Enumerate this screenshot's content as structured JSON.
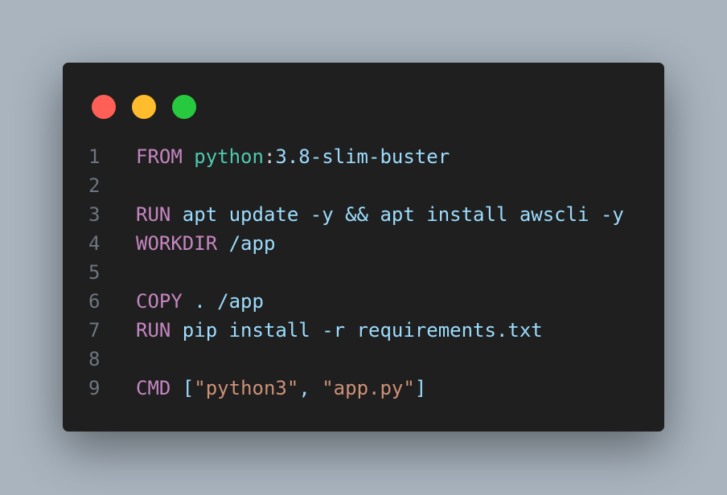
{
  "window_controls": [
    {
      "name": "close",
      "color": "#ff5f56"
    },
    {
      "name": "minimize",
      "color": "#ffbd2e"
    },
    {
      "name": "maximize",
      "color": "#27c93f"
    }
  ],
  "code": {
    "language": "Dockerfile",
    "lines": [
      {
        "number": "1",
        "tokens": [
          {
            "t": "FROM",
            "c": "kw"
          },
          {
            "t": " ",
            "c": "id"
          },
          {
            "t": "python",
            "c": "ty"
          },
          {
            "t": ":",
            "c": "pu"
          },
          {
            "t": "3.8-slim-buster",
            "c": "id"
          }
        ]
      },
      {
        "number": "2",
        "tokens": []
      },
      {
        "number": "3",
        "tokens": [
          {
            "t": "RUN",
            "c": "kw"
          },
          {
            "t": " apt update -y && apt install awscli -y",
            "c": "id"
          }
        ]
      },
      {
        "number": "4",
        "tokens": [
          {
            "t": "WORKDIR",
            "c": "kw"
          },
          {
            "t": " /app",
            "c": "id"
          }
        ]
      },
      {
        "number": "5",
        "tokens": []
      },
      {
        "number": "6",
        "tokens": [
          {
            "t": "COPY",
            "c": "kw"
          },
          {
            "t": " . /app",
            "c": "id"
          }
        ]
      },
      {
        "number": "7",
        "tokens": [
          {
            "t": "RUN",
            "c": "kw"
          },
          {
            "t": " pip install -r requirements.txt",
            "c": "id"
          }
        ]
      },
      {
        "number": "8",
        "tokens": []
      },
      {
        "number": "9",
        "tokens": [
          {
            "t": "CMD",
            "c": "kw"
          },
          {
            "t": " [",
            "c": "id"
          },
          {
            "t": "\"python3\"",
            "c": "st"
          },
          {
            "t": ", ",
            "c": "id"
          },
          {
            "t": "\"app.py\"",
            "c": "st"
          },
          {
            "t": "]",
            "c": "id"
          }
        ]
      }
    ]
  }
}
